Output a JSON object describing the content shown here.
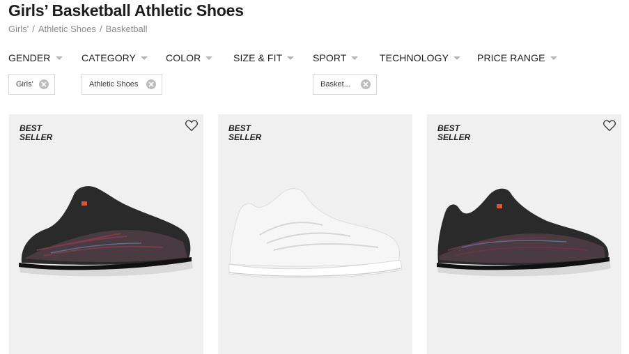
{
  "page": {
    "title": "Girls’ Basketball Athletic Shoes"
  },
  "breadcrumb": [
    "Girls'",
    "Athletic Shoes",
    "Basketball"
  ],
  "breadcrumb_separator": "/",
  "filters": {
    "gender": "GENDER",
    "category": "CATEGORY",
    "color": "COLOR",
    "size_fit": "SIZE & FIT",
    "sport": "SPORT",
    "technology": "TECHNOLOGY",
    "price_range": "PRICE RANGE"
  },
  "active_filters": {
    "gender": "Girls'",
    "category": "Athletic Shoes",
    "sport": "Basket..."
  },
  "products": [
    {
      "badge": "BEST SELLER",
      "has_wishlist_icon": true,
      "shoe_color": "#2a2a2a",
      "accent_color": "#7a3b4a"
    },
    {
      "badge": "BEST SELLER",
      "has_wishlist_icon": false,
      "shoe_color": "#f4f4f4",
      "accent_color": "#e6e6e6"
    },
    {
      "badge": "BEST SELLER",
      "has_wishlist_icon": true,
      "shoe_color": "#2a2a2a",
      "accent_color": "#6b3444"
    }
  ],
  "icons": {
    "filter_caret": "chevron-down-icon",
    "chip_remove": "close-circle-icon",
    "wishlist": "heart-outline-icon"
  }
}
